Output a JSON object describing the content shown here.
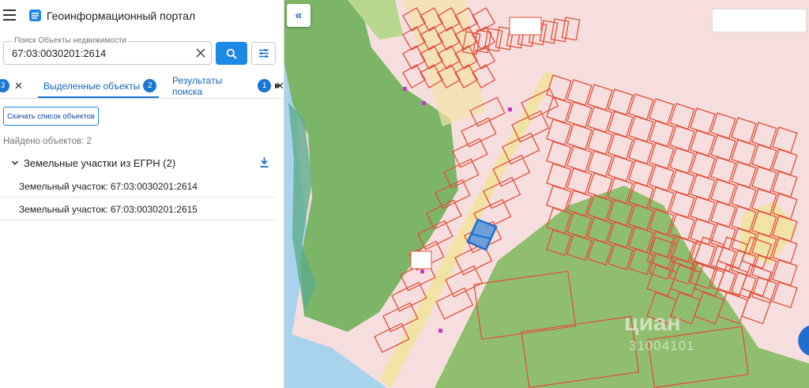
{
  "header": {
    "title": "Геоинформационный портал"
  },
  "search": {
    "label": "Поиск Объекты недвижимости",
    "value": "67:03:0030201:2614"
  },
  "tabs": [
    {
      "badge": "3"
    },
    {
      "label": "Выделенные объекты",
      "badge": "2",
      "active": true
    },
    {
      "label": "Результаты поиска",
      "badge": "1"
    }
  ],
  "results": {
    "download_button": "Скачать список объектов",
    "found": "Найдено объектов: 2",
    "group_label": "Земельные участки из ЕГРН (2)",
    "items": [
      "Земельный участок: 67:03:0030201:2614",
      "Земельный участок: 67:03:0030201:2615"
    ]
  },
  "map": {
    "watermark": "циан",
    "watermark_id": "31004101"
  },
  "colors": {
    "accent": "#1e88e5",
    "parcel_border": "#e0503c",
    "parcel_fill": "#f7dede",
    "forest": "#7cb567",
    "road": "#f3e2a6",
    "water": "#a9d3ec",
    "selected": "#1e6fd0"
  },
  "icons": [
    "menu-icon",
    "logo-icon",
    "close-icon",
    "search-icon",
    "filter-icon",
    "chevron-down-icon",
    "download-icon",
    "double-chevron-left-icon"
  ]
}
